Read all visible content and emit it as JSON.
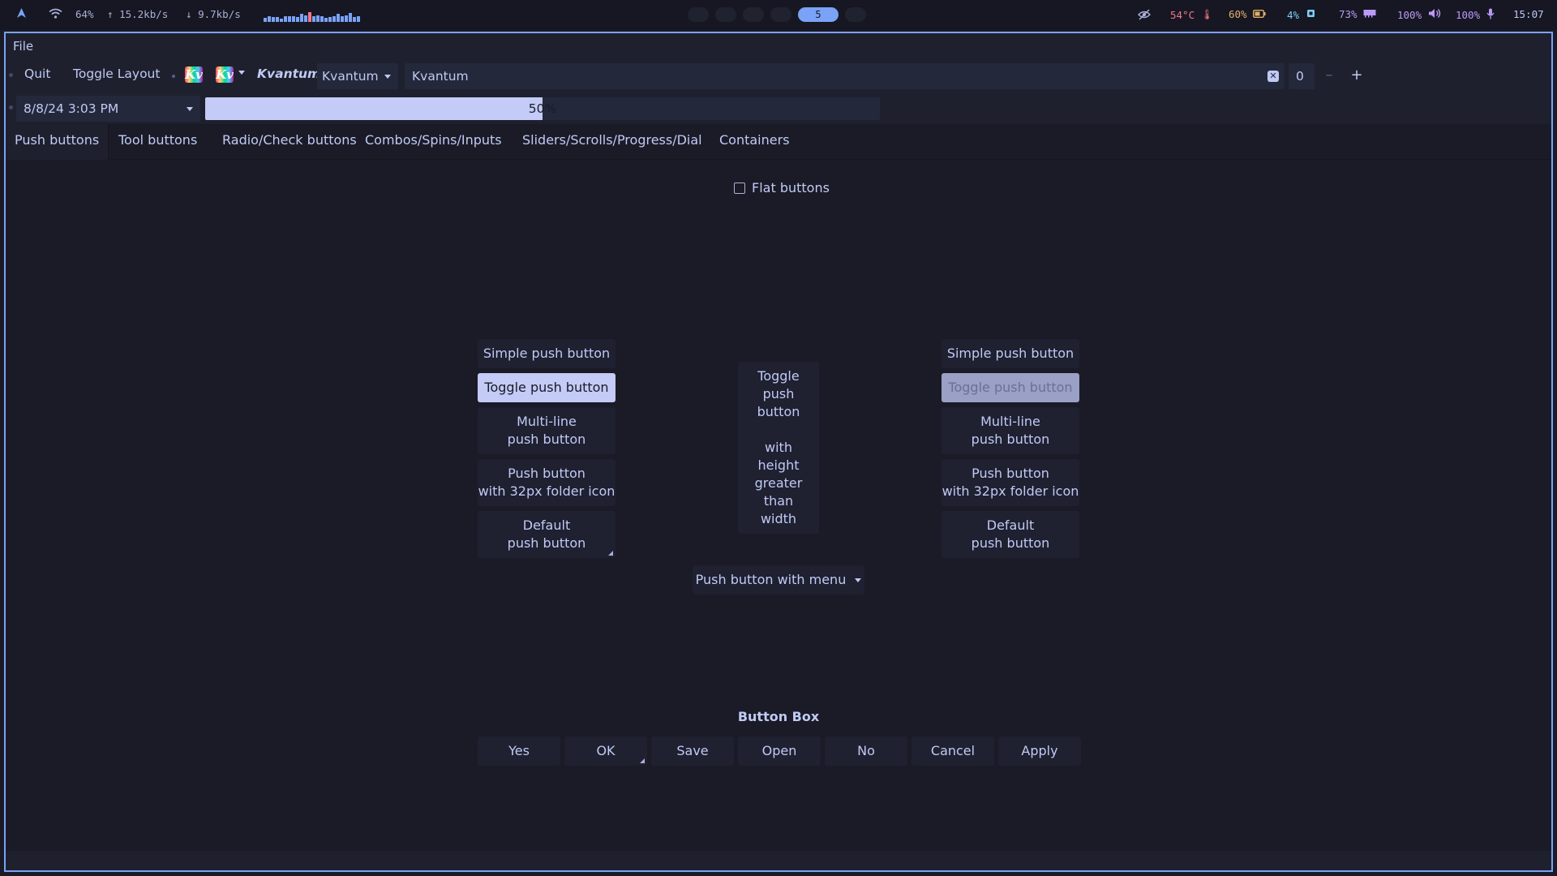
{
  "system_bar": {
    "launcher_icon": "arch-icon",
    "wifi_icon": "wifi-icon",
    "wifi": "64%",
    "upload": "15.2kb/s",
    "download": "9.7kb/s",
    "netgraph_levels": [
      0.4,
      0.6,
      0.5,
      0.5,
      0.3,
      0.6,
      0.6,
      0.6,
      0.5,
      0.8,
      0.7,
      1.0,
      0.6,
      0.7,
      0.6,
      0.4,
      0.5,
      0.6,
      0.8,
      0.6,
      0.7,
      0.9,
      0.5,
      0.6
    ],
    "active_workspace": "5",
    "eye_icon": "eye-off-icon",
    "temperature": "54°C",
    "battery": "60%",
    "cpu": "4%",
    "memory": "73%",
    "volume": "100%",
    "mic": "100%",
    "clock": "15:07",
    "colors": {
      "accent": "#7aa2f7",
      "temp": "#f7768e",
      "battery": "#e0af68",
      "cpu": "#7dcfff",
      "mem": "#bb9af7"
    }
  },
  "menubar": {
    "file": "File"
  },
  "toolbar": {
    "quit": "Quit",
    "toggle_layout": "Toggle Layout",
    "kv_logo": "Kv",
    "kvantum_label": "Kvantum",
    "combo_value": "Kvantum",
    "line_edit_value": "Kvantum",
    "spin_value": "0",
    "spin_minus": "–",
    "spin_plus": "+"
  },
  "row2": {
    "datetime": "8/8/24 3:03 PM",
    "progress_value": 50,
    "progress_text": "50%"
  },
  "tabs": [
    {
      "label": "Push buttons"
    },
    {
      "label": "Tool buttons"
    },
    {
      "label": "Radio/Check buttons"
    },
    {
      "label": "Combos/Spins/Inputs"
    },
    {
      "label": "Sliders/Scrolls/Progress/Dial"
    },
    {
      "label": "Containers"
    }
  ],
  "content": {
    "flat_buttons_label": "Flat buttons",
    "left_column": {
      "simple": "Simple push button",
      "toggle": "Toggle push button",
      "multiline": "Multi-line\npush button",
      "folder_icon": "Push button\nwith 32px folder icon",
      "default": "Default\npush button"
    },
    "center_column": {
      "tall_toggle": "Toggle\npush\nbutton\n\nwith\nheight\ngreater\nthan\nwidth",
      "menu_button": "Push button with menu"
    },
    "right_column": {
      "simple": "Simple push button",
      "toggle": "Toggle push button",
      "multiline": "Multi-line\npush button",
      "folder_icon": "Push button\nwith 32px folder icon",
      "default": "Default\npush button"
    },
    "button_box": {
      "title": "Button Box",
      "buttons": [
        "Yes",
        "OK",
        "Save",
        "Open",
        "No",
        "Cancel",
        "Apply"
      ]
    }
  }
}
